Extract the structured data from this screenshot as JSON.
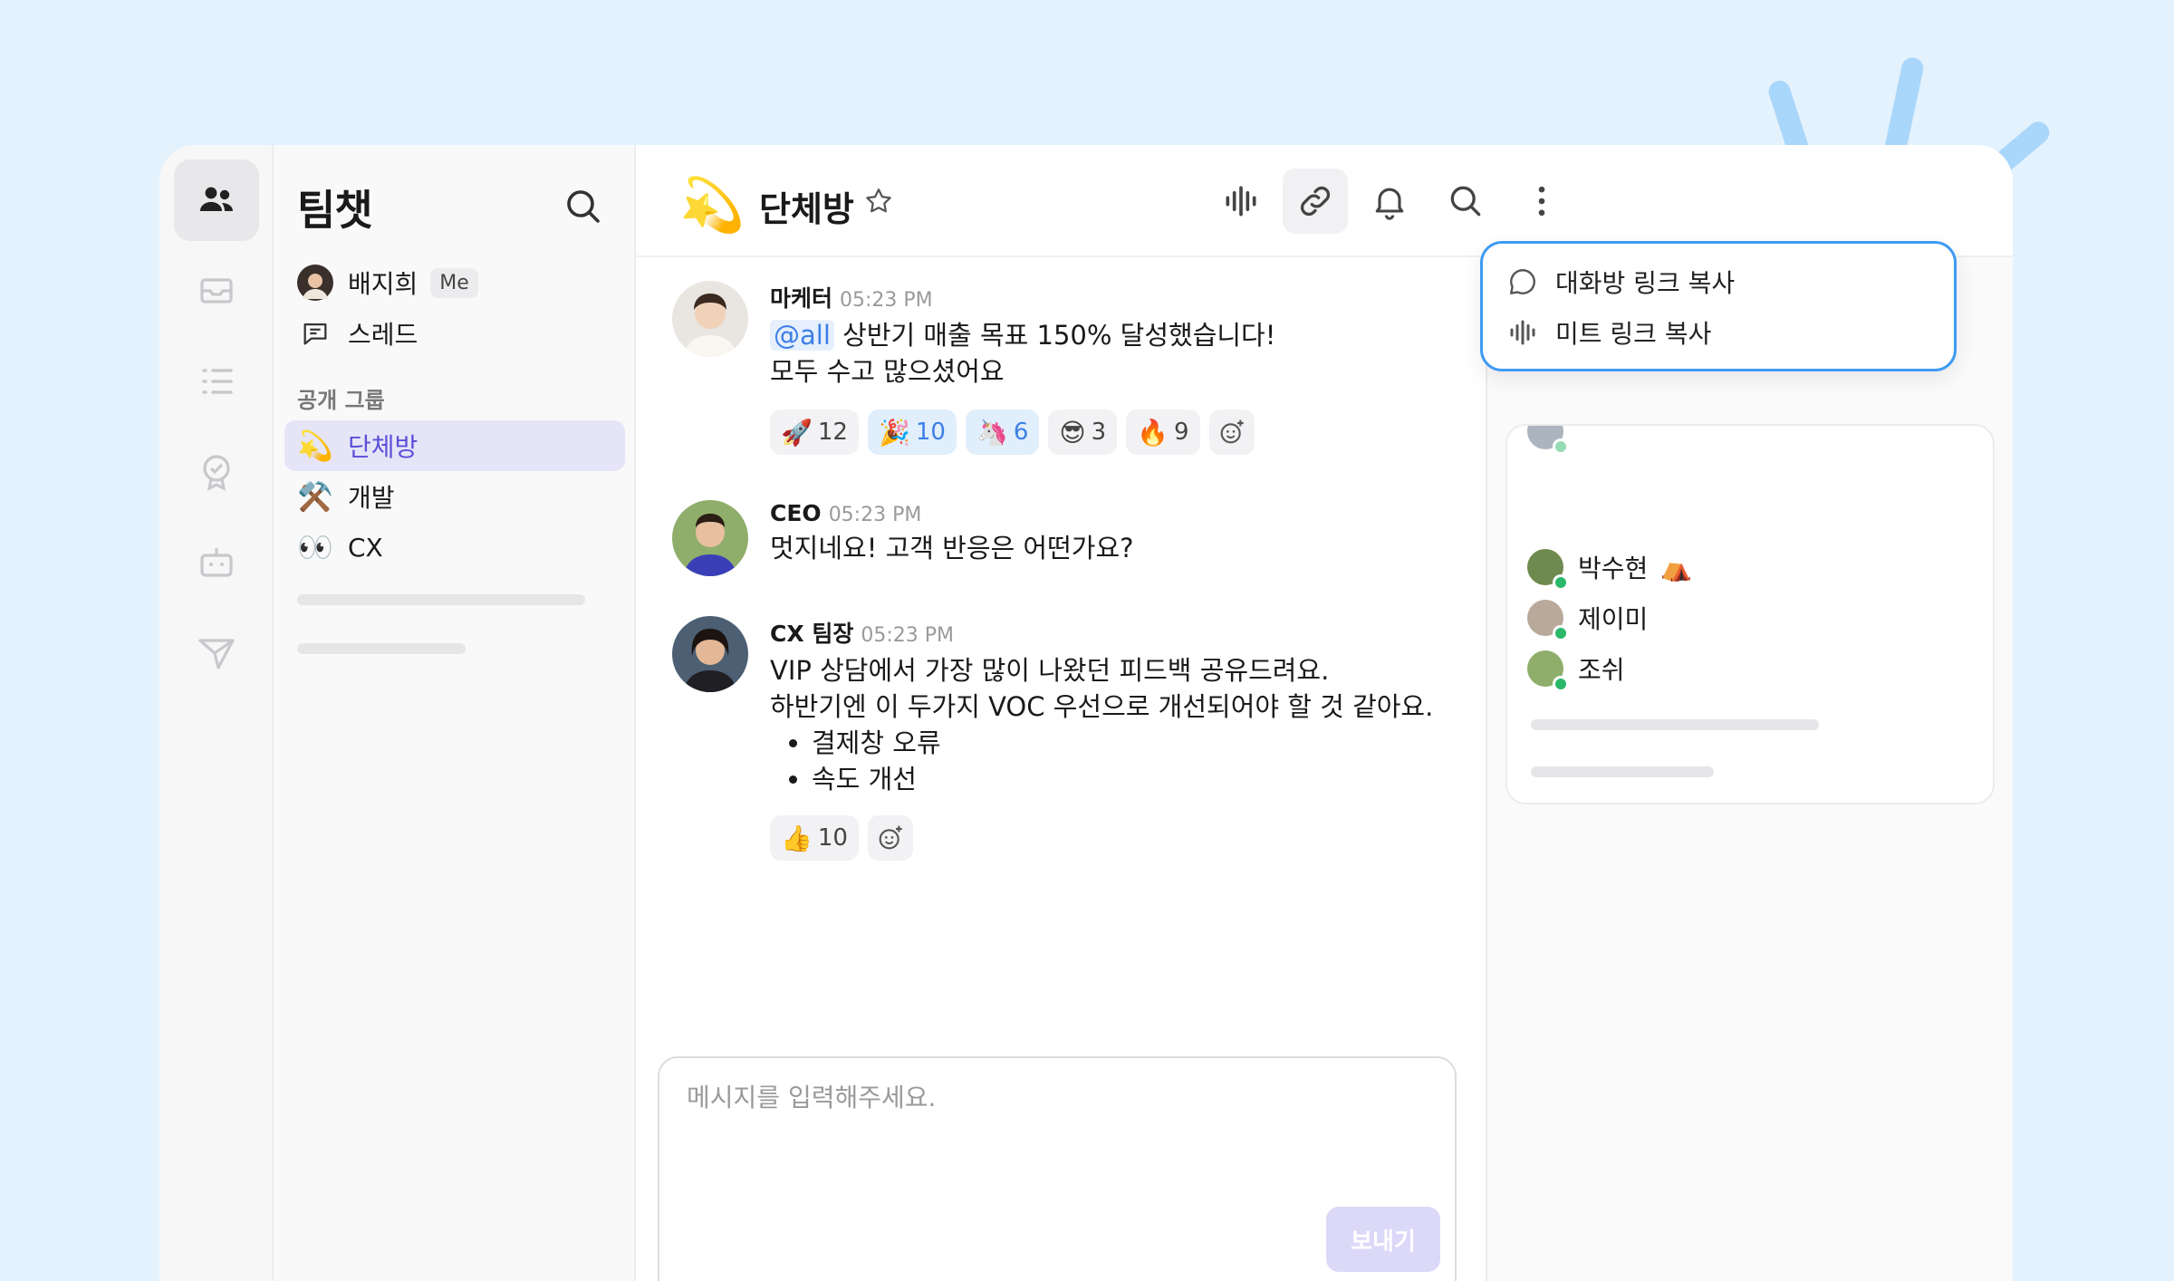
{
  "sidebar": {
    "title": "팀챗",
    "me": {
      "name": "배지희",
      "badge": "Me"
    },
    "threads_label": "스레드",
    "section_label": "공개 그룹",
    "channels": [
      {
        "emoji": "💫",
        "name": "단체방",
        "active": true
      },
      {
        "emoji": "⚒️",
        "name": "개발",
        "active": false
      },
      {
        "emoji": "👀",
        "name": "CX",
        "active": false
      }
    ]
  },
  "header": {
    "emoji": "💫",
    "title": "단체방",
    "icons": [
      "voice-icon",
      "link-icon",
      "bell-icon",
      "search-icon",
      "more-icon"
    ]
  },
  "popup": {
    "items": [
      {
        "icon": "chat-bubble-icon",
        "label": "대화방 링크 복사"
      },
      {
        "icon": "voice-icon",
        "label": "미트 링크 복사"
      }
    ]
  },
  "messages": [
    {
      "author": "마케터",
      "time": "05:23 PM",
      "mention": "@all",
      "line1": " 상반기 매출 목표 150% 달성했습니다!",
      "line2": "모두 수고 많으셨어요",
      "reactions": [
        {
          "emoji": "🚀",
          "count": "12",
          "mine": false
        },
        {
          "emoji": "🎉",
          "count": "10",
          "mine": true
        },
        {
          "emoji": "🦄",
          "count": "6",
          "mine": true
        },
        {
          "emoji": "😎",
          "count": "3",
          "mine": false
        },
        {
          "emoji": "🔥",
          "count": "9",
          "mine": false
        }
      ]
    },
    {
      "author": "CEO",
      "time": "05:23 PM",
      "line1": "멋지네요! 고객 반응은 어떤가요?"
    },
    {
      "author": "CX 팀장",
      "time": "05:23 PM",
      "line1": "VIP 상담에서 가장 많이 나왔던 피드백 공유드려요.",
      "line2": "하반기엔 이 두가지 VOC 우선으로 개선되어야 할 것 같아요.",
      "bullets": [
        "결제창 오류",
        "속도 개선"
      ],
      "reactions": [
        {
          "emoji": "👍",
          "count": "10",
          "mine": false
        }
      ]
    }
  ],
  "composer": {
    "placeholder": "메시지를 입력해주세요.",
    "send_label": "보내기"
  },
  "members": [
    {
      "name": "박수현",
      "emoji": "⛺"
    },
    {
      "name": "제이미",
      "emoji": ""
    },
    {
      "name": "조쉬",
      "emoji": ""
    }
  ],
  "colors": {
    "accent": "#5b4fd9",
    "popup_border": "#3f9bf2",
    "online": "#2cb86a",
    "background": "#e4f2fd"
  }
}
